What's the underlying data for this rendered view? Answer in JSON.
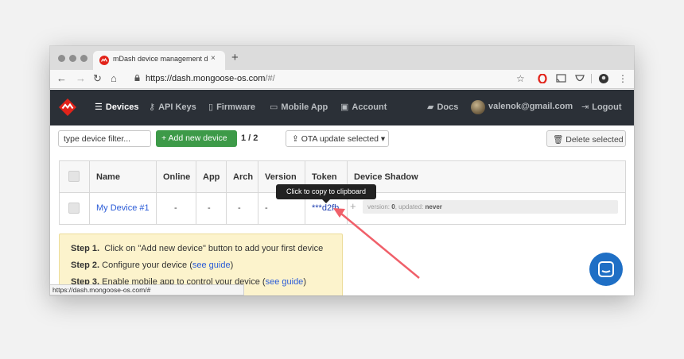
{
  "browser": {
    "tab_title": "mDash device management da",
    "tab_close": "×",
    "new_tab": "+",
    "url_host": "https://dash.mongoose-os.com",
    "url_path": "/#/",
    "status_url": "https://dash.mongoose-os.com/#"
  },
  "nav": {
    "devices": "Devices",
    "api_keys": "API Keys",
    "firmware": "Firmware",
    "mobile_app": "Mobile App",
    "account": "Account",
    "docs": "Docs",
    "user": "valenok@gmail.com",
    "logout": "Logout"
  },
  "toolbar": {
    "filter_placeholder": "type device filter...",
    "add_label": "Add new device",
    "count": "1 / 2",
    "ota_label": "OTA update selected",
    "delete_label": "Delete selected"
  },
  "table": {
    "headers": [
      "Name",
      "Online",
      "App",
      "Arch",
      "Version",
      "Token",
      "Device Shadow"
    ],
    "rows": [
      {
        "name": "My Device #1",
        "online": "-",
        "app": "-",
        "arch": "-",
        "version": "-",
        "token": "***d2fb",
        "shadow_version_label": "version:",
        "shadow_version": "0",
        "shadow_updated_label": ", updated:",
        "shadow_updated": "never"
      }
    ]
  },
  "tooltip": "Click to copy to clipboard",
  "help": {
    "step1_label": "Step 1.",
    "step1_text": "Click on \"Add new device\" button to add your first device",
    "step2_label": "Step 2.",
    "step2_text": "Configure your device (",
    "step2_link": "see guide",
    "step2_end": ")",
    "step3_label": "Step 3.",
    "step3_text": "Enable mobile app to control your device (",
    "step3_link": "see guide",
    "step3_end": ")"
  },
  "colors": {
    "nav_bg": "#2b3037",
    "brand_red": "#e2231a",
    "add_green": "#3d9a48",
    "link_blue": "#2a5bd7",
    "help_bg": "#fcf3cc",
    "chat_blue": "#1f6fc5",
    "arrow_red": "#f0606a"
  }
}
